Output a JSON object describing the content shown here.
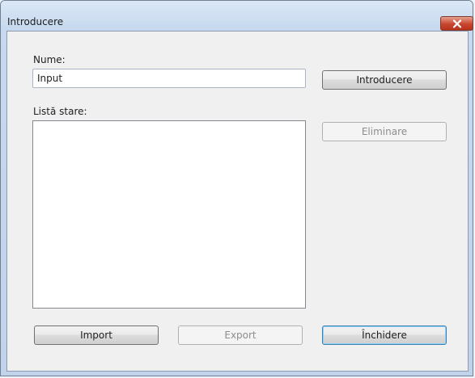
{
  "window": {
    "title": "Introducere"
  },
  "form": {
    "name_label": "Nume:",
    "name_value": "Input",
    "list_label": "Listă stare:",
    "list_items": []
  },
  "buttons": {
    "introduce": "Introducere",
    "delete": "Eliminare",
    "import": "Import",
    "export": "Export",
    "close": "Închidere"
  },
  "colors": {
    "close_button": "#c8452e",
    "default_button_border": "#3c7fb1"
  }
}
